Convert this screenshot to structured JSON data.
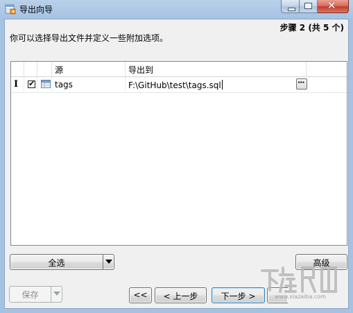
{
  "window": {
    "title": "导出向导"
  },
  "step": "步骤 2 (共 5 个)",
  "description": "你可以选择导出文件并定义一些附加选项。",
  "table": {
    "headers": [
      "",
      "",
      "",
      "源",
      "导出到"
    ],
    "rows": [
      {
        "cursor": "I",
        "checked": "✔",
        "icon": "table-icon",
        "source": "tags",
        "export_to": "F:\\GitHub\\test\\tags.sql",
        "browse_label": "···"
      }
    ]
  },
  "buttons": {
    "select_all": "全选",
    "advanced": "高级",
    "save": "保存",
    "first": "<<",
    "prev": "< 上一步",
    "next": "下一步 >"
  },
  "watermark": {
    "url": "www.xiazaiba.com"
  },
  "colors": {
    "titlebar": "#b9d1ea",
    "close_button": "#c23b2a",
    "client_bg": "#f0f0f0",
    "focus_border": "#3c7fb1"
  }
}
